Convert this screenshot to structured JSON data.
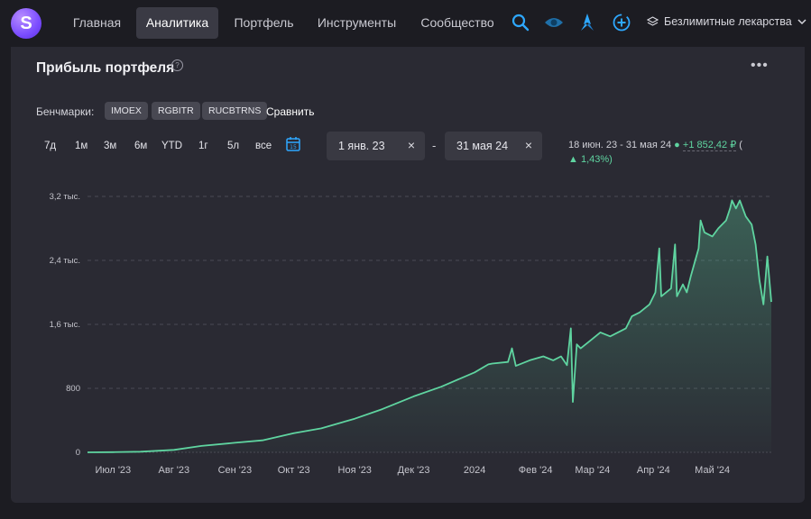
{
  "nav": {
    "logo_letter": "S",
    "tabs": [
      {
        "label": "Главная",
        "active": false
      },
      {
        "label": "Аналитика",
        "active": true
      },
      {
        "label": "Портфель",
        "active": false
      },
      {
        "label": "Инструменты",
        "active": false
      },
      {
        "label": "Сообщество",
        "active": false
      }
    ],
    "icons": [
      "search-icon",
      "eye-icon",
      "rocket-icon",
      "add-circle-icon"
    ],
    "plan_label": "Безлимитные лекарства",
    "accent": "#2ea8ff"
  },
  "card": {
    "title": "Прибыль портфеля",
    "help_glyph": "?",
    "menu_glyph": "•••",
    "benchmarks_label": "Бенчмарки:",
    "benchmarks": [
      "IMOEX",
      "RGBITR",
      "RUCBTRNS"
    ],
    "compare_label": "Сравнить",
    "periods": [
      "7д",
      "1м",
      "3м",
      "6м",
      "YTD",
      "1г",
      "5л",
      "все"
    ],
    "date_from": "1 янв. 23",
    "date_to": "31 мая 24",
    "date_clear": "×",
    "date_separator": "-",
    "range_text": "18 июн. 23 - 31 мая 24",
    "range_change": "+1 852,42 ₽",
    "range_open_paren": "(",
    "range_pct": "1,43%)",
    "calendar_day": "15"
  },
  "colors": {
    "line": "#5fd4a0",
    "grid": "#4a4a55",
    "positive": "#5fd4a0"
  },
  "chart_data": {
    "type": "area",
    "y_ticks": [
      "3,2 тыс.",
      "2,4 тыс.",
      "1,6 тыс.",
      "800",
      "0"
    ],
    "y_tick_values": [
      3200,
      2400,
      1600,
      800,
      0
    ],
    "x_ticks": [
      "Июл '23",
      "Авг '23",
      "Сен '23",
      "Окт '23",
      "Ноя '23",
      "Дек '23",
      "2024",
      "Фев '24",
      "Мар '24",
      "Апр '24",
      "Май '24"
    ],
    "x_tick_dates": [
      "2023-07-01",
      "2023-08-01",
      "2023-09-01",
      "2023-10-01",
      "2023-11-01",
      "2023-12-01",
      "2024-01-01",
      "2024-02-01",
      "2024-03-01",
      "2024-04-01",
      "2024-05-01"
    ],
    "ylim": [
      0,
      3200
    ],
    "xlim": [
      "2023-06-18",
      "2024-05-31"
    ],
    "grid": true,
    "series": [
      {
        "points": [
          [
            "2023-06-18",
            0
          ],
          [
            "2023-07-01",
            2
          ],
          [
            "2023-07-15",
            8
          ],
          [
            "2023-08-01",
            30
          ],
          [
            "2023-08-15",
            80
          ],
          [
            "2023-09-01",
            120
          ],
          [
            "2023-09-15",
            150
          ],
          [
            "2023-10-01",
            240
          ],
          [
            "2023-10-15",
            300
          ],
          [
            "2023-11-01",
            420
          ],
          [
            "2023-11-15",
            540
          ],
          [
            "2023-12-01",
            700
          ],
          [
            "2023-12-15",
            820
          ],
          [
            "2024-01-01",
            1000
          ],
          [
            "2024-01-08",
            1100
          ],
          [
            "2024-01-10",
            1110
          ],
          [
            "2024-01-18",
            1130
          ],
          [
            "2024-01-20",
            1300
          ],
          [
            "2024-01-22",
            1080
          ],
          [
            "2024-01-29",
            1150
          ],
          [
            "2024-02-05",
            1200
          ],
          [
            "2024-02-10",
            1150
          ],
          [
            "2024-02-14",
            1200
          ],
          [
            "2024-02-17",
            1090
          ],
          [
            "2024-02-19",
            1550
          ],
          [
            "2024-02-20",
            630
          ],
          [
            "2024-02-22",
            1350
          ],
          [
            "2024-02-24",
            1300
          ],
          [
            "2024-02-29",
            1400
          ],
          [
            "2024-03-05",
            1500
          ],
          [
            "2024-03-10",
            1450
          ],
          [
            "2024-03-18",
            1550
          ],
          [
            "2024-03-21",
            1700
          ],
          [
            "2024-03-25",
            1750
          ],
          [
            "2024-03-30",
            1850
          ],
          [
            "2024-04-02",
            2000
          ],
          [
            "2024-04-04",
            2550
          ],
          [
            "2024-04-05",
            1950
          ],
          [
            "2024-04-10",
            2050
          ],
          [
            "2024-04-12",
            2600
          ],
          [
            "2024-04-13",
            1950
          ],
          [
            "2024-04-16",
            2100
          ],
          [
            "2024-04-18",
            2000
          ],
          [
            "2024-04-20",
            2200
          ],
          [
            "2024-04-24",
            2550
          ],
          [
            "2024-04-25",
            2900
          ],
          [
            "2024-04-27",
            2750
          ],
          [
            "2024-05-01",
            2700
          ],
          [
            "2024-05-04",
            2800
          ],
          [
            "2024-05-08",
            2900
          ],
          [
            "2024-05-10",
            3050
          ],
          [
            "2024-05-11",
            3150
          ],
          [
            "2024-05-13",
            3050
          ],
          [
            "2024-05-15",
            3150
          ],
          [
            "2024-05-18",
            2950
          ],
          [
            "2024-05-21",
            2850
          ],
          [
            "2024-05-23",
            2600
          ],
          [
            "2024-05-25",
            2150
          ],
          [
            "2024-05-26",
            2000
          ],
          [
            "2024-05-27",
            1850
          ],
          [
            "2024-05-29",
            2450
          ],
          [
            "2024-05-31",
            1880
          ]
        ]
      }
    ]
  }
}
